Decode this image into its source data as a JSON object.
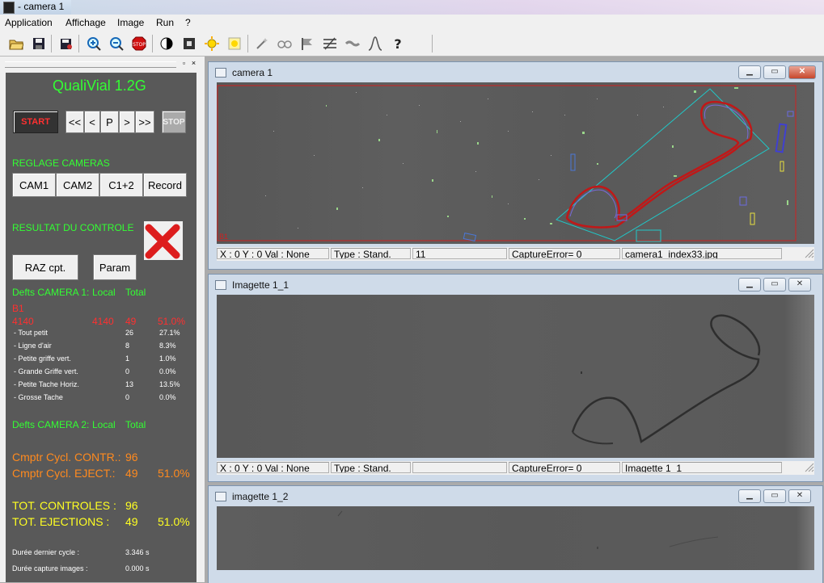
{
  "window": {
    "title": "- camera 1"
  },
  "menu": [
    "Application",
    "Affichage",
    "Image",
    "Run",
    "?"
  ],
  "toolbar_icons": [
    "open-folder-icon",
    "save-icon",
    "save-as-icon",
    "zoom-in-icon",
    "zoom-out-icon",
    "stop-icon",
    "contrast-icon",
    "square-icon",
    "sun-icon",
    "light-icon",
    "wand-icon",
    "glasses-icon",
    "flag-icon",
    "levels-icon",
    "handshake-icon",
    "curve-icon",
    "help-icon"
  ],
  "left": {
    "app_title": "QualiVial 1.2G",
    "start_label": "START",
    "nav": [
      "<<",
      "<",
      "P",
      ">",
      ">>"
    ],
    "stop_label": "STOP",
    "reglage_title": "REGLAGE CAMERAS",
    "cam_buttons": [
      "CAM1",
      "CAM2",
      "C1+2",
      "Record"
    ],
    "resultat_title": "RESULTAT DU CONTROLE",
    "raz_label": "RAZ cpt.",
    "param_label": "Param",
    "defects1_header": "Defts CAMERA 1:",
    "col_local": "Local",
    "col_total": "Total",
    "b1_label": "B1",
    "b1_row": {
      "a": "4140",
      "b": "4140",
      "c": "49",
      "d": "51.0%"
    },
    "defects": [
      {
        "name": "- Tout petit",
        "count": "26",
        "pct": "27.1%"
      },
      {
        "name": "- Ligne d'air",
        "count": "8",
        "pct": "8.3%"
      },
      {
        "name": "- Petite griffe vert.",
        "count": "1",
        "pct": "1.0%"
      },
      {
        "name": "- Grande Griffe vert.",
        "count": "0",
        "pct": "0.0%"
      },
      {
        "name": "- Petite Tache Horiz.",
        "count": "13",
        "pct": "13.5%"
      },
      {
        "name": "- Grosse Tache",
        "count": "0",
        "pct": "0.0%"
      }
    ],
    "defects2_header": "Defts CAMERA 2:",
    "cmptr_contr_label": "Cmptr Cycl. CONTR.:",
    "cmptr_contr_value": "96",
    "cmptr_eject_label": "Cmptr Cycl. EJECT.:",
    "cmptr_eject_value": "49",
    "cmptr_eject_pct": "51.0%",
    "tot_controles_label": "TOT. CONTROLES :",
    "tot_controles_value": "96",
    "tot_ejections_label": "TOT. EJECTIONS :",
    "tot_ejections_value": "49",
    "tot_ejections_pct": "51.0%",
    "duree_cycle_label": "Durée dernier cycle :",
    "duree_cycle_value": "3.346 s",
    "duree_capture_label": "Durée capture images :",
    "duree_capture_value": "0.000 s"
  },
  "windows": {
    "camera1": {
      "title": "camera 1",
      "roi_label": "B1",
      "status": [
        "X : 0 Y : 0 Val : None",
        "Type : Stand.",
        "11",
        "CaptureError= 0",
        "camera1_index33.jpg"
      ]
    },
    "imagette11": {
      "title": "Imagette 1_1",
      "status": [
        "X : 0 Y : 0 Val : None",
        "Type : Stand.",
        "",
        "CaptureError= 0",
        "Imagette 1_1"
      ]
    },
    "imagette12": {
      "title": "imagette 1_2"
    }
  },
  "colors": {
    "accent_green": "#33ff33",
    "orange": "#ff8a1e",
    "yellow": "#ffff22",
    "red": "#ff3030",
    "panel": "#595959"
  }
}
